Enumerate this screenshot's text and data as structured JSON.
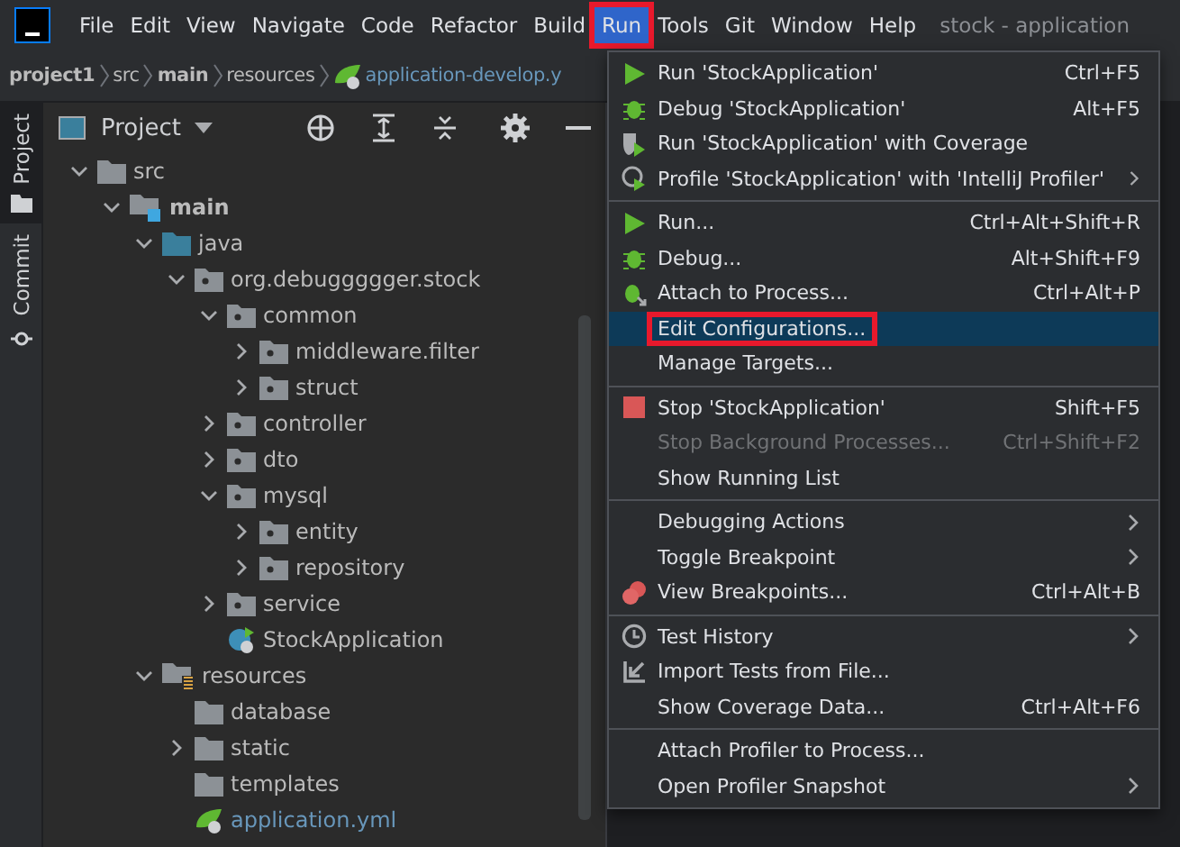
{
  "menubar": {
    "items": [
      {
        "label": "File",
        "selected": false,
        "annotated": false
      },
      {
        "label": "Edit",
        "selected": false,
        "annotated": false
      },
      {
        "label": "View",
        "selected": false,
        "annotated": false
      },
      {
        "label": "Navigate",
        "selected": false,
        "annotated": false
      },
      {
        "label": "Code",
        "selected": false,
        "annotated": false
      },
      {
        "label": "Refactor",
        "selected": false,
        "annotated": false
      },
      {
        "label": "Build",
        "selected": false,
        "annotated": false
      },
      {
        "label": "Run",
        "selected": true,
        "annotated": true
      },
      {
        "label": "Tools",
        "selected": false,
        "annotated": false
      },
      {
        "label": "Git",
        "selected": false,
        "annotated": false
      },
      {
        "label": "Window",
        "selected": false,
        "annotated": false
      },
      {
        "label": "Help",
        "selected": false,
        "annotated": false
      }
    ],
    "title": "stock - application"
  },
  "breadcrumb": [
    {
      "label": "project1",
      "kind": "bold"
    },
    {
      "label": "src",
      "kind": "plain"
    },
    {
      "label": "main",
      "kind": "bold"
    },
    {
      "label": "resources",
      "kind": "plain"
    },
    {
      "label": "application-develop.y",
      "kind": "file"
    }
  ],
  "tool_strip": [
    {
      "label": "Project",
      "selected": true
    },
    {
      "label": "Commit",
      "selected": false
    }
  ],
  "project_panel": {
    "title": "Project",
    "tree": [
      {
        "label": "src",
        "kind": "folder",
        "expanded": true,
        "children": [
          {
            "label": "main",
            "kind": "source-root",
            "expanded": true,
            "children": [
              {
                "label": "java",
                "kind": "source-folder",
                "expanded": true,
                "children": [
                  {
                    "label": "org.debuggggger.stock",
                    "kind": "package",
                    "expanded": true,
                    "children": [
                      {
                        "label": "common",
                        "kind": "package",
                        "expanded": true,
                        "children": [
                          {
                            "label": "middleware.filter",
                            "kind": "package",
                            "expanded": false
                          },
                          {
                            "label": "struct",
                            "kind": "package",
                            "expanded": false
                          }
                        ]
                      },
                      {
                        "label": "controller",
                        "kind": "package",
                        "expanded": false
                      },
                      {
                        "label": "dto",
                        "kind": "package",
                        "expanded": false
                      },
                      {
                        "label": "mysql",
                        "kind": "package",
                        "expanded": true,
                        "children": [
                          {
                            "label": "entity",
                            "kind": "package",
                            "expanded": false
                          },
                          {
                            "label": "repository",
                            "kind": "package",
                            "expanded": false
                          }
                        ]
                      },
                      {
                        "label": "service",
                        "kind": "package",
                        "expanded": false
                      },
                      {
                        "label": "StockApplication",
                        "kind": "app-class"
                      }
                    ]
                  }
                ]
              },
              {
                "label": "resources",
                "kind": "resources-folder",
                "expanded": true,
                "children": [
                  {
                    "label": "database",
                    "kind": "folder"
                  },
                  {
                    "label": "static",
                    "kind": "folder",
                    "expanded": false
                  },
                  {
                    "label": "templates",
                    "kind": "folder"
                  },
                  {
                    "label": "application.yml",
                    "kind": "config-file"
                  }
                ]
              }
            ]
          }
        ]
      }
    ]
  },
  "run_menu": {
    "groups": [
      [
        {
          "label": "Run 'StockApplication'",
          "shortcut": "Ctrl+F5",
          "kind": "run"
        },
        {
          "label": "Debug 'StockApplication'",
          "shortcut": "Alt+F5",
          "kind": "debug"
        },
        {
          "label": "Run 'StockApplication' with Coverage",
          "kind": "coverage"
        },
        {
          "label": "Profile 'StockApplication' with 'IntelliJ Profiler'",
          "kind": "profile",
          "submenu": true
        }
      ],
      [
        {
          "label": "Run...",
          "shortcut": "Ctrl+Alt+Shift+R",
          "kind": "run"
        },
        {
          "label": "Debug...",
          "shortcut": "Alt+Shift+F9",
          "kind": "debug"
        },
        {
          "label": "Attach to Process...",
          "shortcut": "Ctrl+Alt+P",
          "kind": "attach"
        },
        {
          "label": "Edit Configurations...",
          "selected": true,
          "annotated": true
        },
        {
          "label": "Manage Targets..."
        }
      ],
      [
        {
          "label": "Stop 'StockApplication'",
          "shortcut": "Shift+F5",
          "kind": "stop"
        },
        {
          "label": "Stop Background Processes...",
          "shortcut": "Ctrl+Shift+F2",
          "disabled": true
        },
        {
          "label": "Show Running List"
        }
      ],
      [
        {
          "label": "Debugging Actions",
          "submenu": true
        },
        {
          "label": "Toggle Breakpoint",
          "submenu": true
        },
        {
          "label": "View Breakpoints...",
          "shortcut": "Ctrl+Alt+B",
          "kind": "breakpoints"
        }
      ],
      [
        {
          "label": "Test History",
          "submenu": true,
          "kind": "history"
        },
        {
          "label": "Import Tests from File...",
          "kind": "import"
        },
        {
          "label": "Show Coverage Data...",
          "shortcut": "Ctrl+Alt+F6"
        }
      ],
      [
        {
          "label": "Attach Profiler to Process..."
        },
        {
          "label": "Open Profiler Snapshot",
          "submenu": true
        }
      ]
    ]
  }
}
